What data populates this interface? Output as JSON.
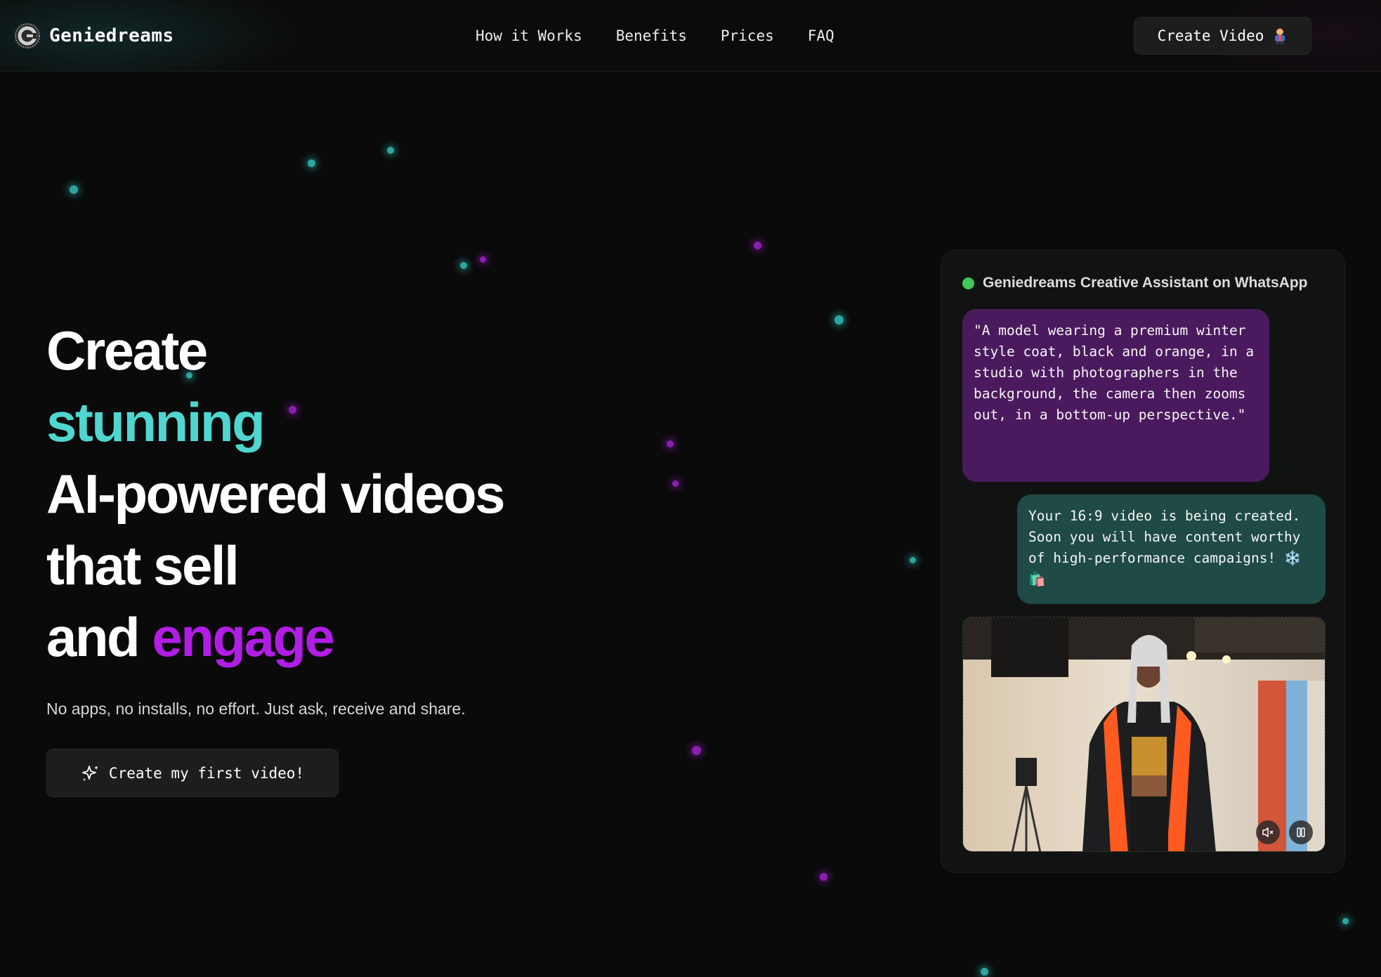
{
  "header": {
    "logo_text": "Geniedreams",
    "nav": [
      "How it Works",
      "Benefits",
      "Prices",
      "FAQ"
    ],
    "cta_label": "Create Video"
  },
  "hero": {
    "line1": "Create",
    "line2": "stunning",
    "line3": "AI-powered videos",
    "line4": "that sell",
    "line5_prefix": "and ",
    "line5_highlight": "engage",
    "subtitle": "No apps, no installs, no effort. Just ask, receive and share.",
    "cta_label": "Create my first video!"
  },
  "chat": {
    "title": "Geniedreams Creative Assistant on WhatsApp",
    "user_message": "\"A model wearing a premium winter style coat, black and orange, in a studio with photographers in the background, the camera then zooms out, in a bottom-up perspective.\"",
    "bot_message": "Your 16:9 video is being created. Soon you will have content worthy of high-performance campaigns! ❄️🛍️"
  },
  "colors": {
    "background": "#0a0a0a",
    "teal_accent": "#4fd6d0",
    "purple_accent": "#b21de6",
    "user_bubble": "#4b1a5e",
    "bot_bubble": "#1f4a45",
    "online": "#3fc75a"
  },
  "icons": {
    "logo": "geniedreams-logo-icon",
    "header_cta": "person-emoji-icon",
    "hero_cta": "sparkle-icon",
    "video_controls": [
      "mute-icon",
      "pause-icon"
    ]
  }
}
